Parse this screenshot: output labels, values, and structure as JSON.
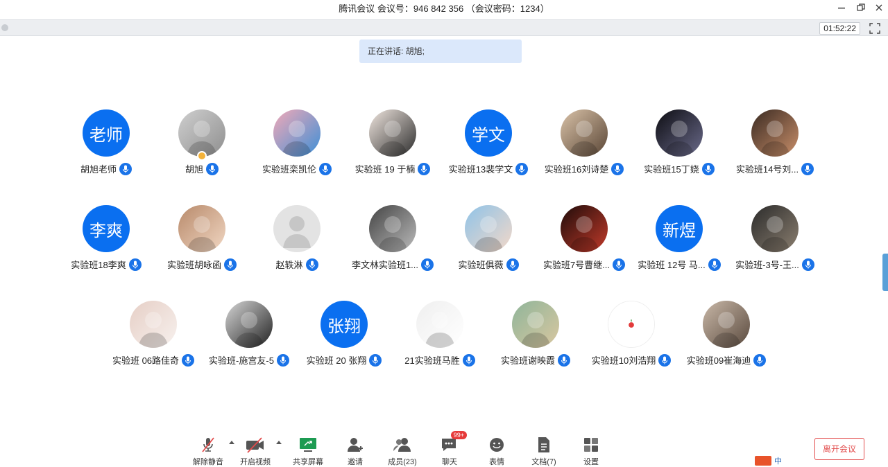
{
  "window": {
    "title": "腾讯会议  会议号：946 842 356 （会议密码：1234）"
  },
  "timer": "01:52:22",
  "speaking": "正在讲话: 胡旭;",
  "colors": {
    "accent": "#1a73e8",
    "avatar_bg": "#0a6ff0",
    "leave": "#e24b4b"
  },
  "participants": [
    {
      "name": "胡旭老师",
      "avatar_text": "老师"
    },
    {
      "name": "胡旭",
      "avatar_text": ""
    },
    {
      "name": "实验班栾凯伦",
      "avatar_text": ""
    },
    {
      "name": "实验班 19 于楠",
      "avatar_text": ""
    },
    {
      "name": "实验班13裴学文",
      "avatar_text": "学文"
    },
    {
      "name": "实验班16刘诗楚",
      "avatar_text": ""
    },
    {
      "name": "实验班15丁娆",
      "avatar_text": ""
    },
    {
      "name": "实验班14号刘...",
      "avatar_text": ""
    },
    {
      "name": "实验班18李爽",
      "avatar_text": "李爽"
    },
    {
      "name": "实验班胡咏函",
      "avatar_text": ""
    },
    {
      "name": "赵轶淋",
      "avatar_text": ""
    },
    {
      "name": "李文林实验班1...",
      "avatar_text": ""
    },
    {
      "name": "实验班俱薇",
      "avatar_text": ""
    },
    {
      "name": "实验班7号曹继...",
      "avatar_text": ""
    },
    {
      "name": "实验班 12号  马...",
      "avatar_text": "新煜"
    },
    {
      "name": "实验班-3号-王...",
      "avatar_text": ""
    },
    {
      "name": "实验班 06路佳奇",
      "avatar_text": ""
    },
    {
      "name": "实验班-施宫友-5",
      "avatar_text": ""
    },
    {
      "name": "实验班 20 张翔",
      "avatar_text": "张翔"
    },
    {
      "name": "21实验班马胜",
      "avatar_text": ""
    },
    {
      "name": "实验班谢映霞",
      "avatar_text": ""
    },
    {
      "name": "实验班10刘浩翔",
      "avatar_text": ""
    },
    {
      "name": "实验班09崔海迪",
      "avatar_text": ""
    }
  ],
  "toolbar": {
    "unmute": "解除静音",
    "start_video": "开启视频",
    "share_screen": "共享屏幕",
    "invite": "邀请",
    "members": "成员(23)",
    "chat": "聊天",
    "chat_badge": "99+",
    "reactions": "表情",
    "docs": "文档(7)",
    "settings": "设置"
  },
  "leave_label": "离开会议",
  "ime": {
    "label": "中"
  }
}
